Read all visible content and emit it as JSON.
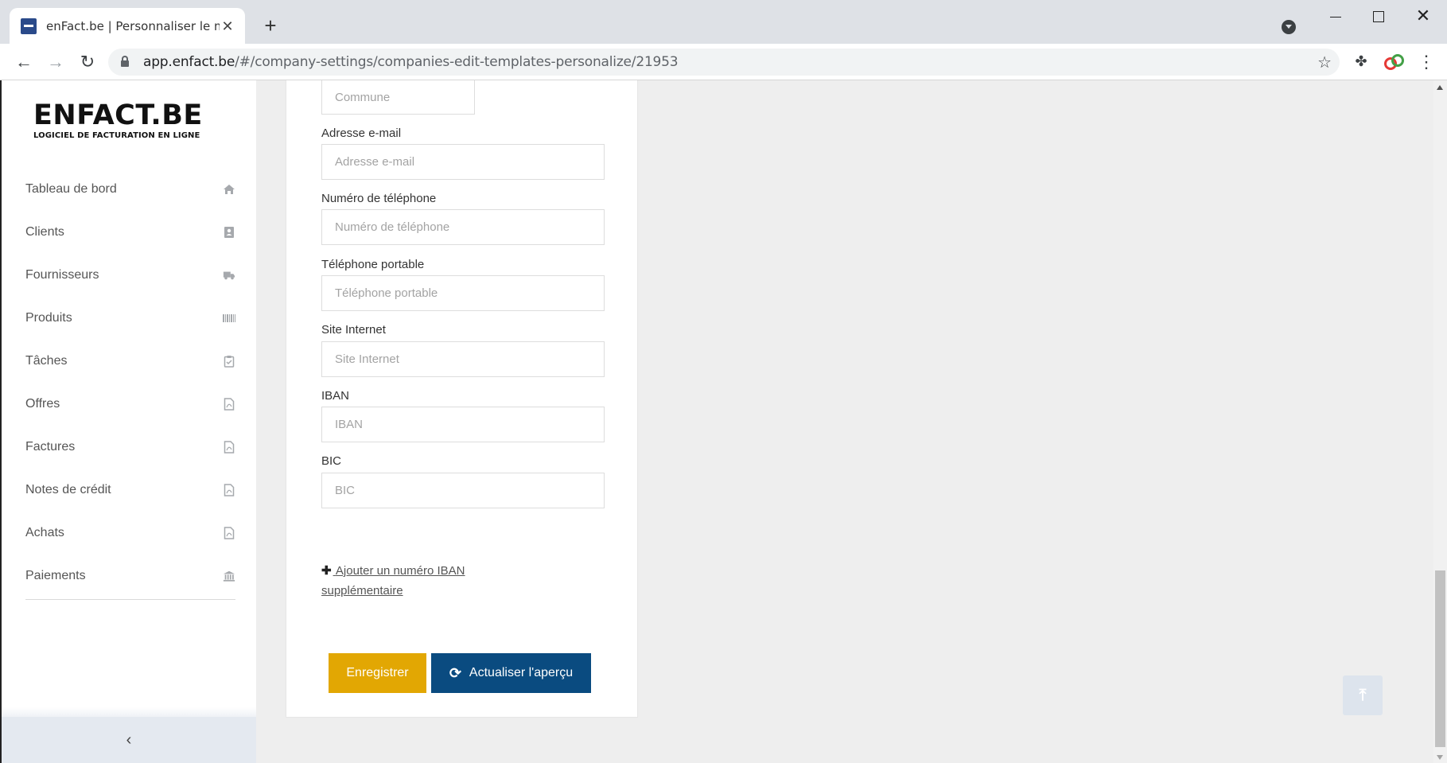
{
  "browser": {
    "tab_title": "enFact.be | Personnaliser le modèle",
    "url_host": "app.enfact.be",
    "url_path": "/#/company-settings/companies-edit-templates-personalize/21953"
  },
  "logo": {
    "main": "ENFACT.BE",
    "sub": "LOGICIEL DE FACTURATION EN LIGNE"
  },
  "sidebar": {
    "items": [
      {
        "label": "Tableau de bord",
        "icon": "home-icon"
      },
      {
        "label": "Clients",
        "icon": "address-book-icon"
      },
      {
        "label": "Fournisseurs",
        "icon": "truck-icon"
      },
      {
        "label": "Produits",
        "icon": "barcode-icon"
      },
      {
        "label": "Tâches",
        "icon": "clipboard-check-icon"
      },
      {
        "label": "Offres",
        "icon": "file-pdf-icon"
      },
      {
        "label": "Factures",
        "icon": "file-pdf-icon"
      },
      {
        "label": "Notes de crédit",
        "icon": "file-pdf-icon"
      },
      {
        "label": "Achats",
        "icon": "file-pdf-icon"
      },
      {
        "label": "Paiements",
        "icon": "bank-icon"
      }
    ]
  },
  "form": {
    "commune_placeholder": "Commune",
    "email": {
      "label": "Adresse e-mail",
      "placeholder": "Adresse e-mail"
    },
    "phone": {
      "label": "Numéro de téléphone",
      "placeholder": "Numéro de téléphone"
    },
    "mobile": {
      "label": "Téléphone portable",
      "placeholder": "Téléphone portable"
    },
    "website": {
      "label": "Site Internet",
      "placeholder": "Site Internet"
    },
    "iban": {
      "label": "IBAN",
      "placeholder": "IBAN"
    },
    "bic": {
      "label": "BIC",
      "placeholder": "BIC"
    },
    "add_iban_line1": "Ajouter un numéro IBAN",
    "add_iban_line2": "supplémentaire",
    "save_label": "Enregistrer",
    "preview_label": "Actualiser l'aperçu"
  },
  "colors": {
    "save": "#e2a703",
    "preview": "#0a4b80"
  }
}
